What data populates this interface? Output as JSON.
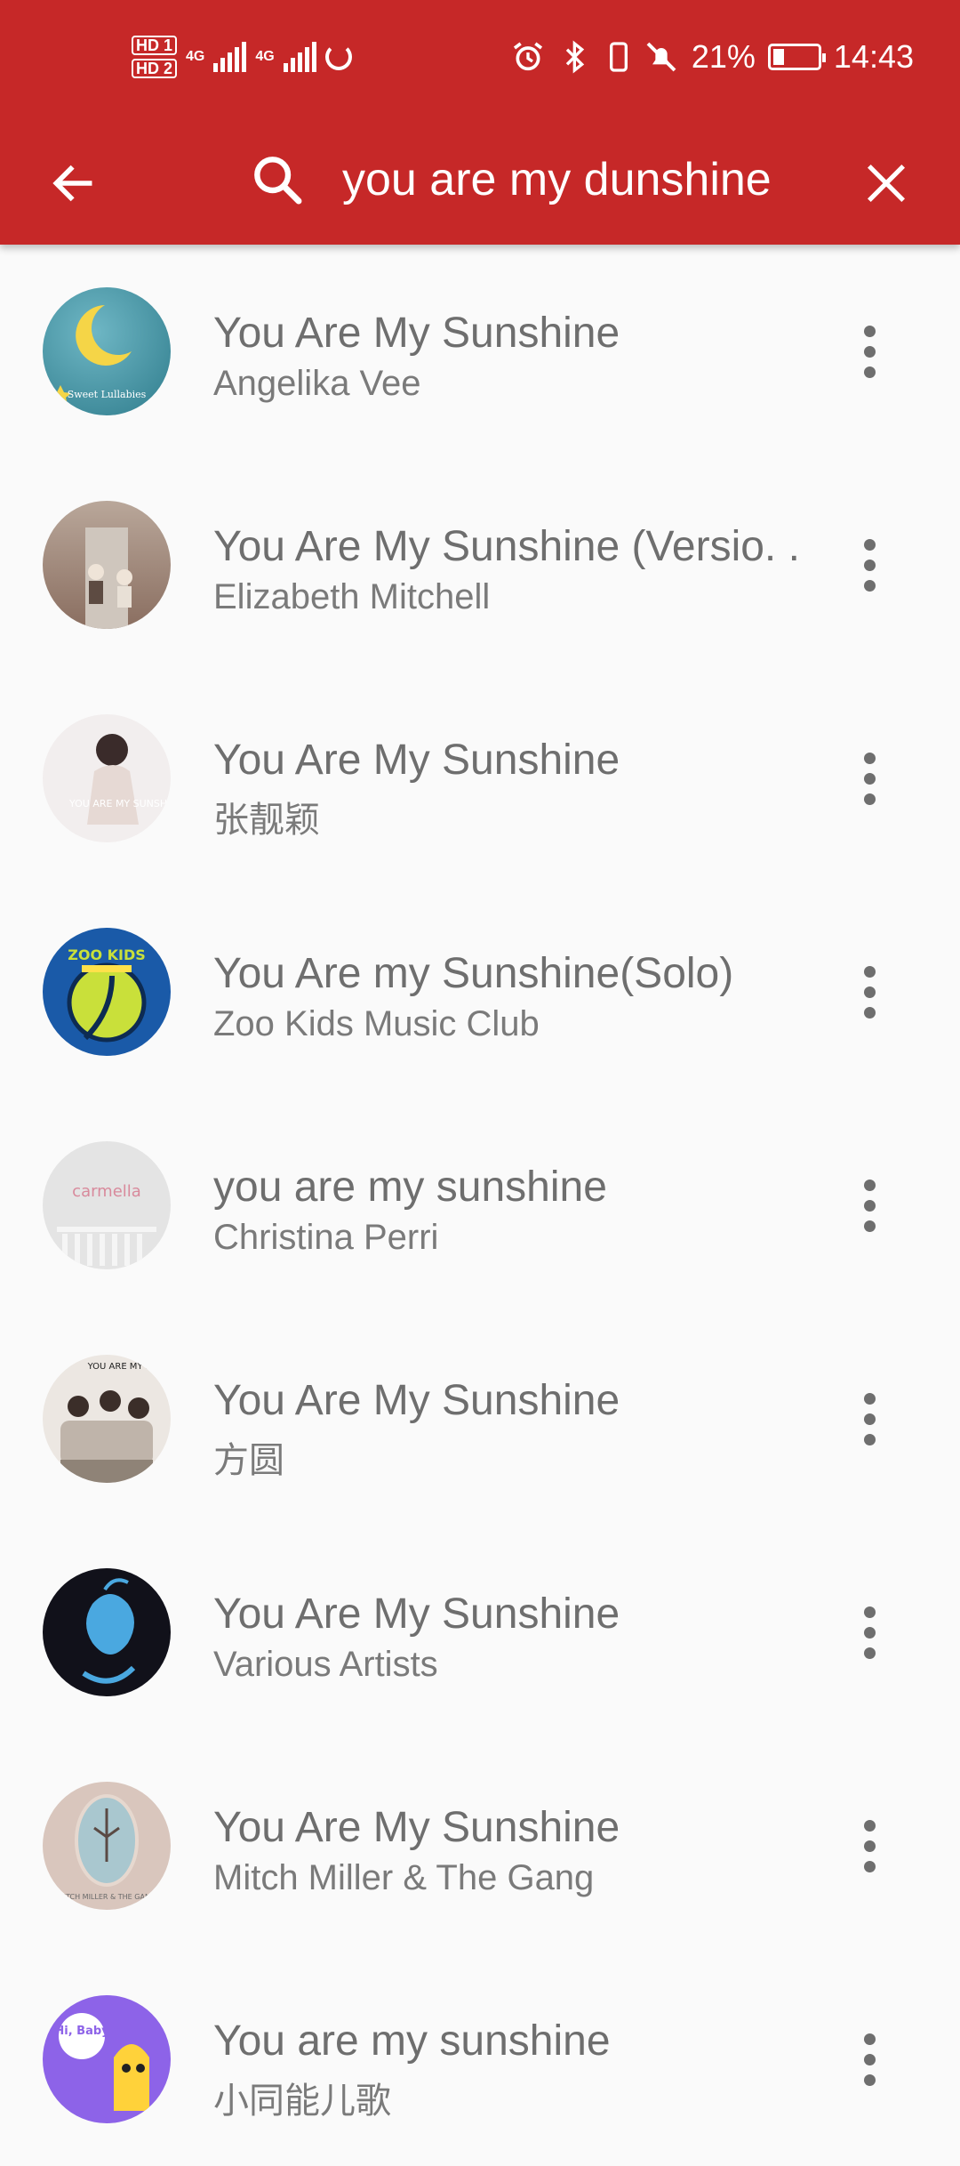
{
  "status_bar": {
    "hd1": "HD 1",
    "hd2": "HD 2",
    "net1": "4G",
    "net2": "4G",
    "battery_percent": "21%",
    "time": "14:43",
    "icons": [
      "alarm-icon",
      "bluetooth-icon",
      "vibrate-icon",
      "mute-icon",
      "battery-charging-icon"
    ]
  },
  "toolbar": {
    "back_icon": "arrow-left-icon",
    "search_icon": "search-icon",
    "query": "you are my dunshine",
    "clear_icon": "close-icon"
  },
  "colors": {
    "toolbar_bg": "#c62828",
    "list_bg": "#fafafa",
    "title_text": "#6e6e6e",
    "artist_text": "#7a7a7a"
  },
  "results": [
    {
      "title": "You Are My Sunshine",
      "artist": "Angelika Vee",
      "art_label": "Sweet Lullabies"
    },
    {
      "title": "You Are My Sunshine (Versio. .",
      "artist": "Elizabeth Mitchell",
      "art_label": ""
    },
    {
      "title": "You Are My Sunshine",
      "artist": "张靓颖",
      "art_label": "YOU ARE MY SUNSHINE"
    },
    {
      "title": "You Are my Sunshine(Solo)",
      "artist": "Zoo Kids Music Club",
      "art_label": "ZOO KIDS"
    },
    {
      "title": "you are my sunshine",
      "artist": "Christina Perri",
      "art_label": "carmella"
    },
    {
      "title": "You Are My Sunshine",
      "artist": "方圆",
      "art_label": "YOU ARE MY SU"
    },
    {
      "title": "You Are My Sunshine",
      "artist": "Various Artists",
      "art_label": ""
    },
    {
      "title": "You Are My Sunshine",
      "artist": "Mitch Miller & The Gang",
      "art_label": "MITCH MILLER & THE GANG"
    },
    {
      "title": "You are my sunshine",
      "artist": "小同能儿歌",
      "art_label": "Hi, Baby"
    }
  ]
}
